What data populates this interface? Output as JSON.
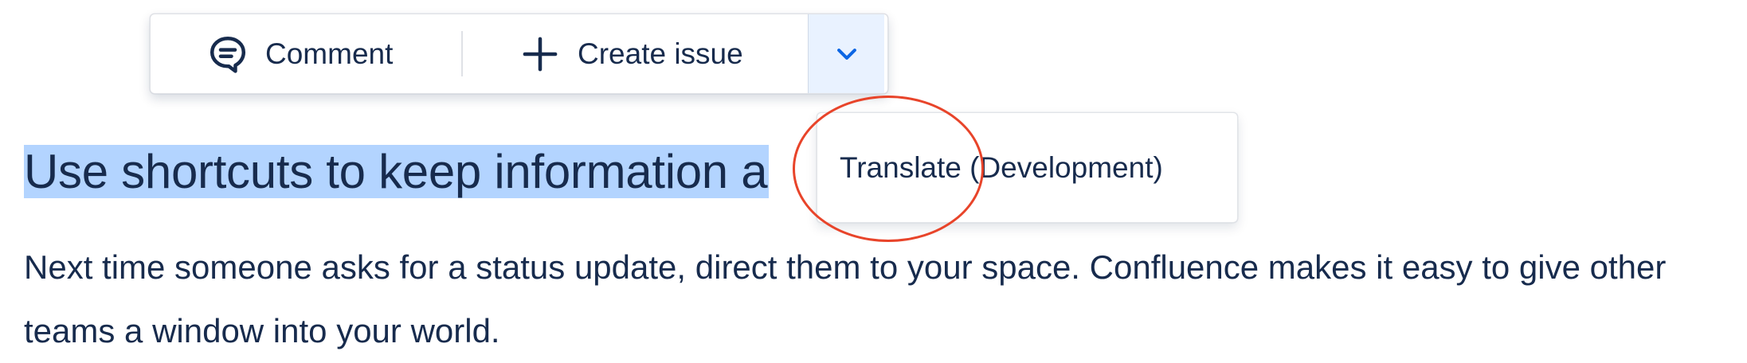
{
  "toolbar": {
    "comment_label": "Comment",
    "create_issue_label": "Create issue",
    "comment_icon": "comment-icon",
    "create_icon": "plus-icon",
    "more_icon": "chevron-down-icon",
    "accent_color": "#0c66e4"
  },
  "dropdown": {
    "items": [
      {
        "label": "Translate (Development)"
      }
    ]
  },
  "content": {
    "heading": "Use shortcuts to keep information a",
    "paragraph": "Next time someone asks for a status update, direct them to your space. Confluence makes it easy to give other teams a window into your world."
  },
  "colors": {
    "text": "#172b4d",
    "selection": "#b3d4ff",
    "annotation": "#e8442a"
  }
}
